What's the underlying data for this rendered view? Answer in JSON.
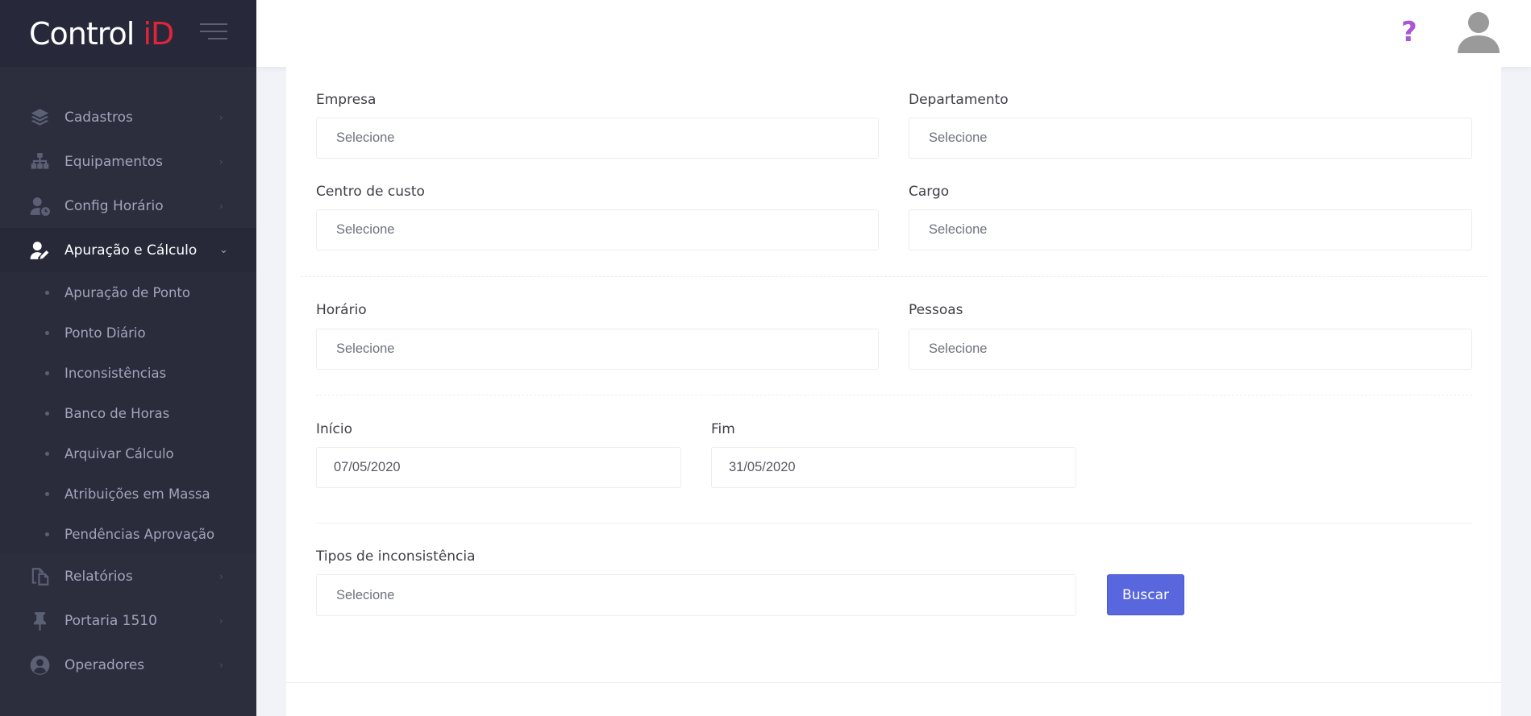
{
  "brand": {
    "logo_main": "Control ",
    "logo_accent": "iD",
    "accent_color": "#e0243a"
  },
  "header": {
    "help_icon": "question-mark-icon",
    "avatar_icon": "user-avatar-icon"
  },
  "sidebar": {
    "items": [
      {
        "label": "Cadastros",
        "icon": "layers-icon"
      },
      {
        "label": "Equipamentos",
        "icon": "sitemap-icon"
      },
      {
        "label": "Config Horário",
        "icon": "user-clock-icon"
      },
      {
        "label": "Apuração e Cálculo",
        "icon": "user-edit-icon",
        "active": true,
        "children": [
          {
            "label": "Apuração de Ponto"
          },
          {
            "label": "Ponto Diário"
          },
          {
            "label": "Inconsistências"
          },
          {
            "label": "Banco de Horas"
          },
          {
            "label": "Arquivar Cálculo"
          },
          {
            "label": "Atribuições em Massa"
          },
          {
            "label": "Pendências Aprovação"
          }
        ]
      },
      {
        "label": "Relatórios",
        "icon": "files-icon"
      },
      {
        "label": "Portaria 1510",
        "icon": "pin-icon"
      },
      {
        "label": "Operadores",
        "icon": "user-circle-icon"
      }
    ]
  },
  "form": {
    "empresa": {
      "label": "Empresa",
      "placeholder": "Selecione"
    },
    "departamento": {
      "label": "Departamento",
      "placeholder": "Selecione"
    },
    "centro_custo": {
      "label": "Centro de custo",
      "placeholder": "Selecione"
    },
    "cargo": {
      "label": "Cargo",
      "placeholder": "Selecione"
    },
    "horario": {
      "label": "Horário",
      "placeholder": "Selecione"
    },
    "pessoas": {
      "label": "Pessoas",
      "placeholder": "Selecione"
    },
    "inicio": {
      "label": "Início",
      "value": "07/05/2020"
    },
    "fim": {
      "label": "Fim",
      "value": "31/05/2020"
    },
    "tipos": {
      "label": "Tipos de inconsistência",
      "placeholder": "Selecione"
    },
    "buscar_label": "Buscar",
    "button_color": "#5867dd"
  }
}
